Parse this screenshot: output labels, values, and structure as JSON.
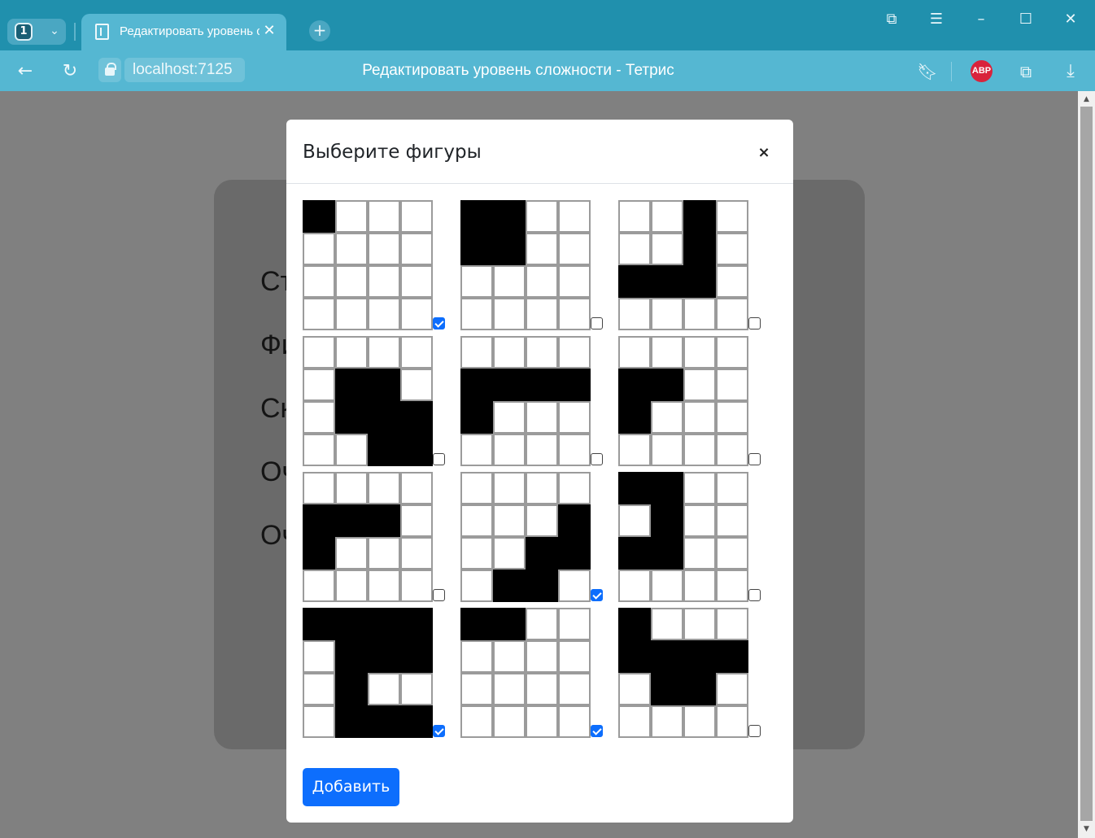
{
  "browser": {
    "tab_count": "1",
    "tab_title": "Редактировать уровень сложности - Тетрис",
    "url": "localhost:7125",
    "page_title": "Редактировать уровень сложности - Тетрис",
    "abp_label": "ABP",
    "accent_color": "#2090ad"
  },
  "background_page": {
    "labels": [
      "Ст",
      "Фи",
      "Ск",
      "Оч",
      "Оч"
    ]
  },
  "modal": {
    "title": "Выберите фигуры",
    "close_symbol": "×",
    "add_button": "Добавить",
    "shapes": [
      {
        "cells": [
          "1000",
          "0000",
          "0000",
          "0000"
        ],
        "checked": true
      },
      {
        "cells": [
          "1100",
          "1100",
          "0000",
          "0000"
        ],
        "checked": false
      },
      {
        "cells": [
          "0010",
          "0010",
          "1110",
          "0000"
        ],
        "checked": false
      },
      {
        "cells": [
          "0000",
          "0110",
          "0111",
          "0011"
        ],
        "checked": false
      },
      {
        "cells": [
          "0000",
          "1111",
          "1000",
          "0000"
        ],
        "checked": false
      },
      {
        "cells": [
          "0000",
          "1100",
          "1000",
          "0000"
        ],
        "checked": false
      },
      {
        "cells": [
          "0000",
          "1110",
          "1000",
          "0000"
        ],
        "checked": false
      },
      {
        "cells": [
          "0000",
          "0001",
          "0011",
          "0110"
        ],
        "checked": true
      },
      {
        "cells": [
          "1100",
          "0100",
          "1100",
          "0000"
        ],
        "checked": false
      },
      {
        "cells": [
          "1111",
          "0111",
          "0100",
          "0111"
        ],
        "checked": true
      },
      {
        "cells": [
          "1100",
          "0000",
          "0000",
          "0000"
        ],
        "checked": true
      },
      {
        "cells": [
          "1000",
          "1111",
          "0110",
          "0000"
        ],
        "checked": false
      }
    ]
  }
}
